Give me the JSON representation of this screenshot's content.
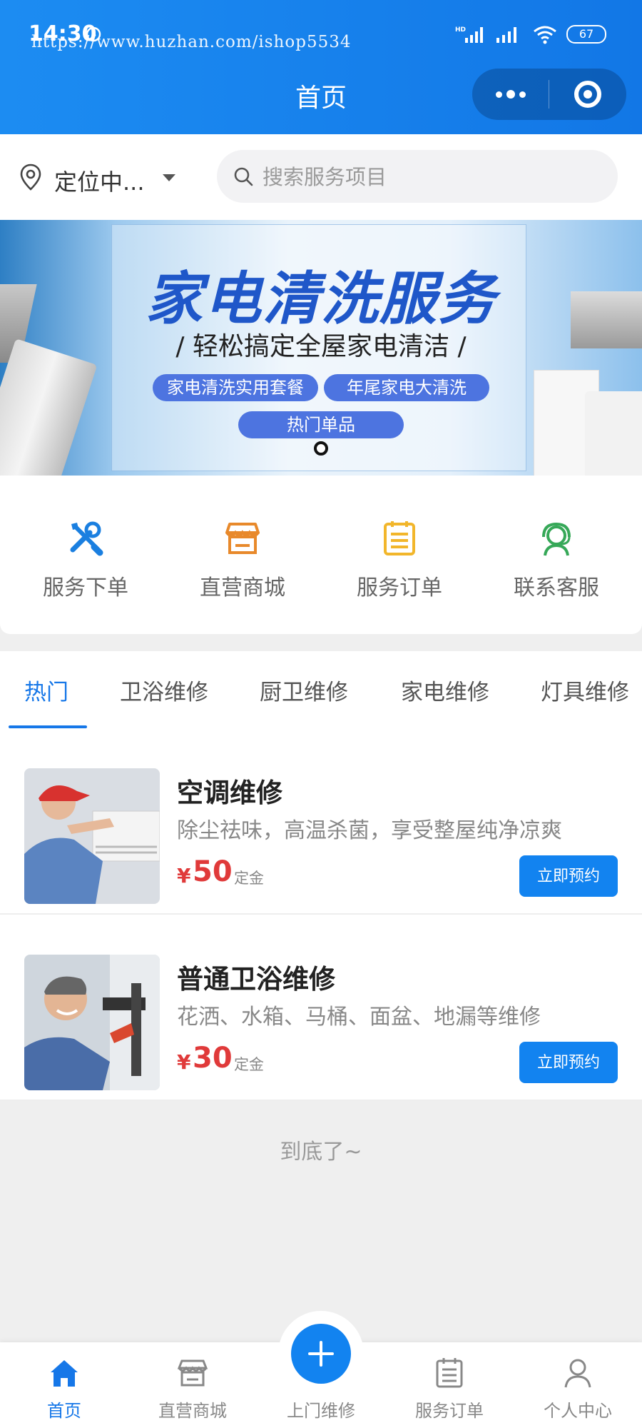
{
  "status_bar": {
    "time": "14:30",
    "watermark": "https://www.huzhan.com/ishop5534",
    "battery": "67"
  },
  "header": {
    "title": "首页"
  },
  "location": {
    "text": "定位中..."
  },
  "search": {
    "placeholder": "搜索服务项目"
  },
  "banner": {
    "title": "家电清洗服务",
    "subtitle": "/ 轻松搞定全屋家电清洁 /",
    "pills": [
      "家电清洗实用套餐",
      "年尾家电大清洗",
      "热门单品"
    ]
  },
  "menu": [
    {
      "label": "服务下单",
      "icon": "tools-icon",
      "color": "#1a7fe0"
    },
    {
      "label": "直营商城",
      "icon": "store-icon",
      "color": "#e8892b"
    },
    {
      "label": "服务订单",
      "icon": "order-icon",
      "color": "#f2b62b"
    },
    {
      "label": "联系客服",
      "icon": "customer-service-icon",
      "color": "#36a858"
    }
  ],
  "tabs": [
    "热门",
    "卫浴维修",
    "厨卫维修",
    "家电维修",
    "灯具维修"
  ],
  "services": [
    {
      "title": "空调维修",
      "desc": "除尘祛味，高温杀菌，享受整屋纯净凉爽",
      "price_symbol": "¥",
      "price": "50",
      "price_unit": "定金",
      "button": "立即预约"
    },
    {
      "title": "普通卫浴维修",
      "desc": "花洒、水箱、马桶、面盆、地漏等维修",
      "price_symbol": "¥",
      "price": "30",
      "price_unit": "定金",
      "button": "立即预约"
    }
  ],
  "end_text": "到底了~",
  "bottom_nav": [
    {
      "label": "首页",
      "icon": "home-icon"
    },
    {
      "label": "直营商城",
      "icon": "store-icon"
    },
    {
      "label": "上门维修",
      "icon": "plus-icon"
    },
    {
      "label": "服务订单",
      "icon": "order-icon"
    },
    {
      "label": "个人中心",
      "icon": "user-icon"
    }
  ],
  "colors": {
    "primary": "#1677e8",
    "price": "#e03a3a"
  }
}
